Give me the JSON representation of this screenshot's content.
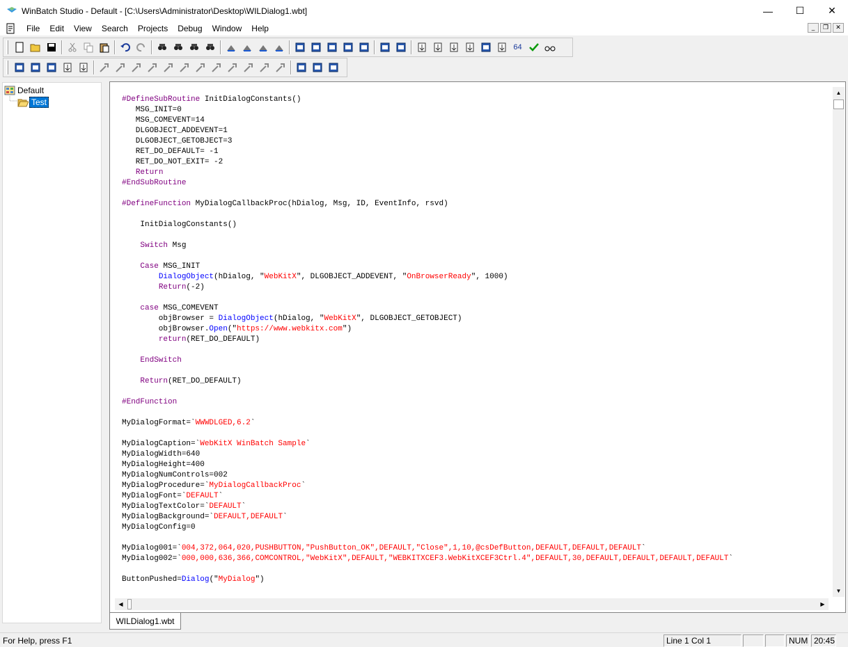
{
  "window": {
    "title": "WinBatch Studio - Default - [C:\\Users\\Administrator\\Desktop\\WILDialog1.wbt]",
    "controls": {
      "minimize": "—",
      "maximize": "☐",
      "close": "✕"
    }
  },
  "menu": {
    "items": [
      "File",
      "Edit",
      "View",
      "Search",
      "Projects",
      "Debug",
      "Window",
      "Help"
    ]
  },
  "toolbar1": {
    "groups": [
      [
        "new-file-icon",
        "open-folder-icon",
        "save-icon"
      ],
      [
        "cut-icon",
        "copy-icon",
        "paste-icon"
      ],
      [
        "undo-icon",
        "redo-icon"
      ],
      [
        "find-icon",
        "find-next-icon",
        "find-prev-icon",
        "replace-icon"
      ],
      [
        "bookmark-icon",
        "bookmark-next-icon",
        "bookmark-prev-icon",
        "bookmark-clear-icon"
      ],
      [
        "dialog-editor-icon",
        "window-spy-icon",
        "pen-icon",
        "compile-icon",
        "stack-icon"
      ],
      [
        "run-icon",
        "run-debug-icon"
      ],
      [
        "step-icon",
        "step-into-icon",
        "step-over-icon",
        "step-out-icon",
        "stop-hand-icon",
        "break-icon"
      ]
    ],
    "label_64": "64"
  },
  "toolbar2": {
    "groups": [
      [
        "project-tree-icon",
        "window-icon",
        "cascade-icon",
        "tile-h-icon",
        "tile-v-icon"
      ],
      [
        "tool-1-icon",
        "tool-2-icon",
        "tool-3-icon",
        "tool-4-icon",
        "tool-5-icon",
        "tool-6-icon",
        "tool-7-icon",
        "tool-8-icon",
        "tool-9-icon",
        "tool-10-icon",
        "tool-11-icon",
        "tool-12-icon"
      ],
      [
        "windows-icon",
        "print-icon",
        "help-index-icon"
      ]
    ]
  },
  "tree": {
    "root": "Default",
    "child": "Test"
  },
  "editor": {
    "tab_label": "WILDialog1.wbt",
    "lines": [
      [
        [
          "kw",
          "#DefineSubRoutine"
        ],
        [
          "p",
          " InitDialogConstants()"
        ]
      ],
      [
        [
          "p",
          "   MSG_INIT=0"
        ]
      ],
      [
        [
          "p",
          "   MSG_COMEVENT=14"
        ]
      ],
      [
        [
          "p",
          "   DLGOBJECT_ADDEVENT=1"
        ]
      ],
      [
        [
          "p",
          "   DLGOBJECT_GETOBJECT=3"
        ]
      ],
      [
        [
          "p",
          "   RET_DO_DEFAULT= -1"
        ]
      ],
      [
        [
          "p",
          "   RET_DO_NOT_EXIT= -2"
        ]
      ],
      [
        [
          "p",
          "   "
        ],
        [
          "kw",
          "Return"
        ]
      ],
      [
        [
          "kw",
          "#EndSubRoutine"
        ]
      ],
      [
        [
          "p",
          ""
        ]
      ],
      [
        [
          "kw",
          "#DefineFunction"
        ],
        [
          "p",
          " MyDialogCallbackProc(hDialog, Msg, ID, EventInfo, rsvd)"
        ]
      ],
      [
        [
          "p",
          ""
        ]
      ],
      [
        [
          "p",
          "    InitDialogConstants()"
        ]
      ],
      [
        [
          "p",
          ""
        ]
      ],
      [
        [
          "p",
          "    "
        ],
        [
          "kw",
          "Switch"
        ],
        [
          "p",
          " Msg"
        ]
      ],
      [
        [
          "p",
          ""
        ]
      ],
      [
        [
          "p",
          "    "
        ],
        [
          "kw",
          "Case"
        ],
        [
          "p",
          " MSG_INIT"
        ]
      ],
      [
        [
          "p",
          "        "
        ],
        [
          "fn",
          "DialogObject"
        ],
        [
          "p",
          "(hDialog, \""
        ],
        [
          "st",
          "WebKitX"
        ],
        [
          "p",
          "\", DLGOBJECT_ADDEVENT, \""
        ],
        [
          "st",
          "OnBrowserReady"
        ],
        [
          "p",
          "\", 1000)"
        ]
      ],
      [
        [
          "p",
          "        "
        ],
        [
          "kw",
          "Return"
        ],
        [
          "p",
          "(-2)"
        ]
      ],
      [
        [
          "p",
          ""
        ]
      ],
      [
        [
          "p",
          "    "
        ],
        [
          "kw",
          "case"
        ],
        [
          "p",
          " MSG_COMEVENT"
        ]
      ],
      [
        [
          "p",
          "        objBrowser = "
        ],
        [
          "fn",
          "DialogObject"
        ],
        [
          "p",
          "(hDialog, \""
        ],
        [
          "st",
          "WebKitX"
        ],
        [
          "p",
          "\", DLGOBJECT_GETOBJECT)"
        ]
      ],
      [
        [
          "p",
          "        objBrowser."
        ],
        [
          "fn",
          "Open"
        ],
        [
          "p",
          "(\""
        ],
        [
          "st",
          "https://www.webkitx.com"
        ],
        [
          "p",
          "\")"
        ]
      ],
      [
        [
          "p",
          "        "
        ],
        [
          "kw",
          "return"
        ],
        [
          "p",
          "(RET_DO_DEFAULT)"
        ]
      ],
      [
        [
          "p",
          ""
        ]
      ],
      [
        [
          "p",
          "    "
        ],
        [
          "kw",
          "EndSwitch"
        ]
      ],
      [
        [
          "p",
          ""
        ]
      ],
      [
        [
          "p",
          "    "
        ],
        [
          "kw",
          "Return"
        ],
        [
          "p",
          "(RET_DO_DEFAULT)"
        ]
      ],
      [
        [
          "p",
          ""
        ]
      ],
      [
        [
          "kw",
          "#EndFunction"
        ]
      ],
      [
        [
          "p",
          ""
        ]
      ],
      [
        [
          "p",
          "MyDialogFormat=`"
        ],
        [
          "st",
          "WWWDLGED,6.2"
        ],
        [
          "p",
          "`"
        ]
      ],
      [
        [
          "p",
          ""
        ]
      ],
      [
        [
          "p",
          "MyDialogCaption=`"
        ],
        [
          "st",
          "WebKitX WinBatch Sample"
        ],
        [
          "p",
          "`"
        ]
      ],
      [
        [
          "p",
          "MyDialogWidth=640"
        ]
      ],
      [
        [
          "p",
          "MyDialogHeight=400"
        ]
      ],
      [
        [
          "p",
          "MyDialogNumControls=002"
        ]
      ],
      [
        [
          "p",
          "MyDialogProcedure=`"
        ],
        [
          "st",
          "MyDialogCallbackProc"
        ],
        [
          "p",
          "`"
        ]
      ],
      [
        [
          "p",
          "MyDialogFont=`"
        ],
        [
          "st",
          "DEFAULT"
        ],
        [
          "p",
          "`"
        ]
      ],
      [
        [
          "p",
          "MyDialogTextColor=`"
        ],
        [
          "st",
          "DEFAULT"
        ],
        [
          "p",
          "`"
        ]
      ],
      [
        [
          "p",
          "MyDialogBackground=`"
        ],
        [
          "st",
          "DEFAULT,DEFAULT"
        ],
        [
          "p",
          "`"
        ]
      ],
      [
        [
          "p",
          "MyDialogConfig=0"
        ]
      ],
      [
        [
          "p",
          ""
        ]
      ],
      [
        [
          "p",
          "MyDialog001=`"
        ],
        [
          "st",
          "004,372,064,020,PUSHBUTTON,\"PushButton_OK\",DEFAULT,\"Close\",1,10,@csDefButton,DEFAULT,DEFAULT,DEFAULT"
        ],
        [
          "p",
          "`"
        ]
      ],
      [
        [
          "p",
          "MyDialog002=`"
        ],
        [
          "st",
          "000,000,636,366,COMCONTROL,\"WebKitX\",DEFAULT,\"WEBKITXCEF3.WebKitXCEF3Ctrl.4\",DEFAULT,30,DEFAULT,DEFAULT,DEFAULT,DEFAULT"
        ],
        [
          "p",
          "`"
        ]
      ],
      [
        [
          "p",
          ""
        ]
      ],
      [
        [
          "p",
          "ButtonPushed="
        ],
        [
          "fn",
          "Dialog"
        ],
        [
          "p",
          "(\""
        ],
        [
          "st",
          "MyDialog"
        ],
        [
          "p",
          "\")"
        ]
      ]
    ]
  },
  "status": {
    "help": "For Help, press F1",
    "position": "Line 1 Col 1",
    "num": "NUM",
    "time": "20:45"
  }
}
